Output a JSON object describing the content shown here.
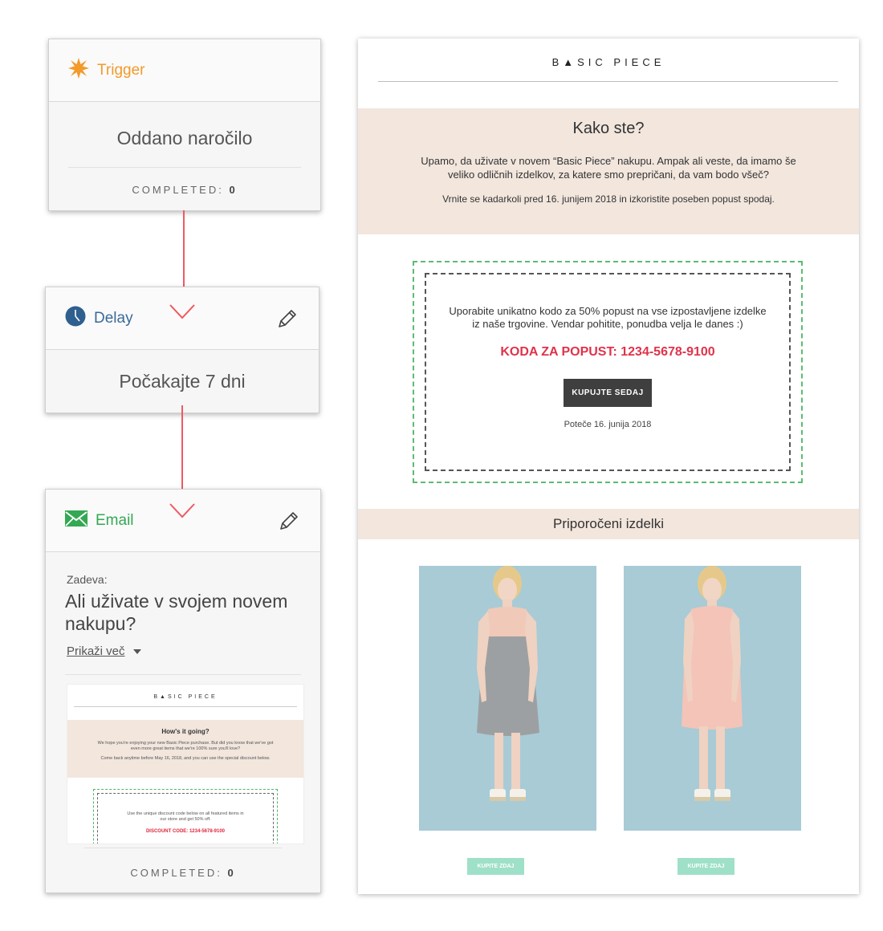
{
  "colors": {
    "trigger_accent": "#f39a2b",
    "delay_accent": "#3a6a9b",
    "email_accent": "#34a853",
    "arrow": "#ef5a61",
    "hero_band": "#f2e6dd",
    "discount_code": "#e0324a",
    "shop_button": "#9fe0c8"
  },
  "workflow": {
    "trigger": {
      "icon": "starburst-icon",
      "title": "Trigger",
      "event": "Oddano naročilo",
      "completed_label": "COMPLETED:",
      "completed_count": "0"
    },
    "delay": {
      "icon": "clock-icon",
      "title": "Delay",
      "description": "Počakajte 7 dni",
      "edit_icon": "pencil-icon"
    },
    "email": {
      "icon": "envelope-icon",
      "title": "Email",
      "edit_icon": "pencil-icon",
      "subject_label": "Zadeva:",
      "subject": "Ali uživate v svojem novem nakupu?",
      "show_more": "Prikaži več",
      "completed_label": "COMPLETED:",
      "completed_count": "0",
      "preview": {
        "brand": "B▲SIC PIECE",
        "heading": "How's it going?",
        "text1": "We hope you're enjoying your new Basic Piece purchase. But did you know that we've got even more great items that we're 100% sure you'll love?",
        "text2": "Come back anytime before May 16, 2018, and you can use the special discount below.",
        "coupon_text": "Use the unique discount code below on all featured items in our store and get 50% off.",
        "coupon_code": "DISCOUNT CODE: 1234-5678-9100"
      }
    }
  },
  "email_preview": {
    "brand": "B▲SIC PIECE",
    "hero_title": "Kako ste?",
    "hero_text": "Upamo, da uživate v novem “Basic Piece” nakupu. Ampak ali veste, da imamo še veliko odličnih izdelkov, za katere smo prepričani, da vam bodo všeč?",
    "hero_text2": "Vrnite se kadarkoli pred 16. junijem 2018 in izkoristite poseben popust spodaj.",
    "coupon_text": "Uporabite unikatno kodo za 50% popust na vse izpostavljene izdelke iz naše trgovine. Vendar pohitite, ponudba velja le danes :)",
    "coupon_code": "KODA ZA POPUST: 1234-5678-9100",
    "buy_button": "KUPUJTE SEDAJ",
    "expires": "Poteče 16. junija 2018",
    "recommended_title": "Priporočeni izdelki",
    "products": [
      {
        "image": "grey-dress-photo",
        "button": "KUPITE ZDAJ"
      },
      {
        "image": "pink-dress-photo",
        "button": "KUPITE ZDAJ"
      }
    ]
  }
}
